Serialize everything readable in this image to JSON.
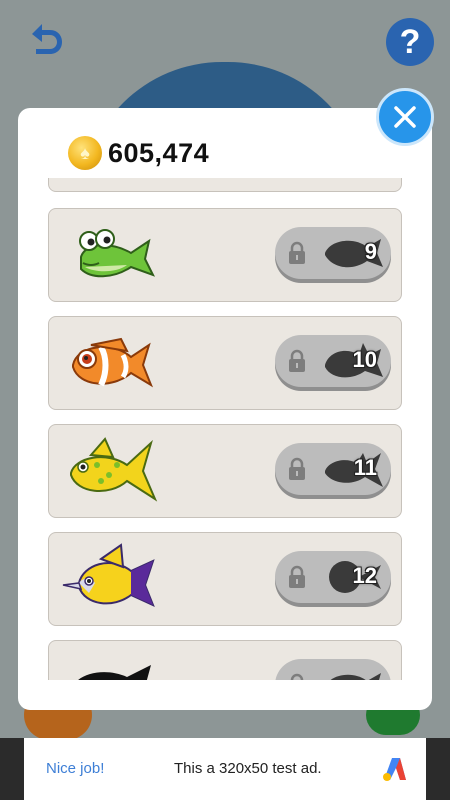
{
  "header": {
    "coins": "605,474",
    "help_label": "?"
  },
  "fish_list": [
    {
      "name": "green-frog-fish",
      "level": "9"
    },
    {
      "name": "clownfish",
      "level": "10"
    },
    {
      "name": "yellow-spotted-fish",
      "level": "11"
    },
    {
      "name": "yellow-tang-fish",
      "level": "12"
    }
  ],
  "ad": {
    "left_text": "Nice job!",
    "center_text": "This a 320x50 test ad."
  }
}
